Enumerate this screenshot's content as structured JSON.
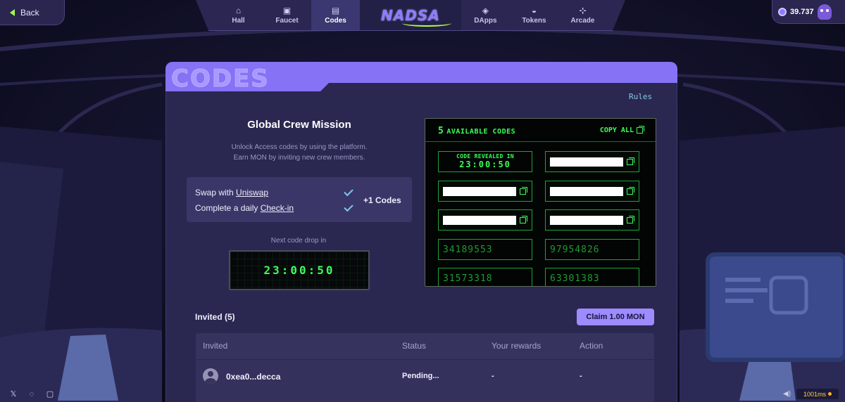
{
  "topbar": {
    "back_label": "Back",
    "nav": [
      {
        "label": "Hall",
        "icon": "home-icon",
        "active": false
      },
      {
        "label": "Faucet",
        "icon": "faucet-icon",
        "active": false
      },
      {
        "label": "Codes",
        "icon": "ticket-icon",
        "active": true
      },
      {
        "label": "DApps",
        "icon": "cube-icon",
        "active": false
      },
      {
        "label": "Tokens",
        "icon": "coin-stack-icon",
        "active": false
      },
      {
        "label": "Arcade",
        "icon": "gamepad-icon",
        "active": false
      }
    ],
    "logo_text": "NADSA",
    "balance": "39.737"
  },
  "panel": {
    "title": "CODES",
    "rules_label": "Rules"
  },
  "mission": {
    "title": "Global Crew Mission",
    "desc_line1": "Unlock Access codes by using the platform.",
    "desc_line2": "Earn MON by inviting new crew members.",
    "task1_prefix": "Swap with ",
    "task1_link": "Uniswap",
    "task2_prefix": "Complete a daily ",
    "task2_link": "Check-in",
    "reward": "+1 Codes",
    "next_drop_label": "Next code drop in",
    "next_drop_timer": "23:00:50"
  },
  "codes": {
    "count": "5",
    "header_label": "AVAILABLE CODES",
    "copy_all_label": "COPY ALL",
    "reveal_label": "CODE REVEALED IN",
    "reveal_timer": "23:00:50",
    "visible_codes": [
      "34189553",
      "97954826",
      "31573318",
      "63301383"
    ]
  },
  "invited": {
    "title": "Invited (5)",
    "claim_label": "Claim 1.00 MON",
    "columns": [
      "Invited",
      "Status",
      "Your rewards",
      "Action"
    ],
    "rows": [
      {
        "name": "0xea0...decca",
        "status": "Pending...",
        "rewards": "-",
        "action": "-"
      }
    ]
  },
  "footer": {
    "ping": "1001ms"
  },
  "colors": {
    "accent": "#8672f5",
    "terminal_green": "#3dff5c",
    "panel_bg": "#2a2850"
  }
}
